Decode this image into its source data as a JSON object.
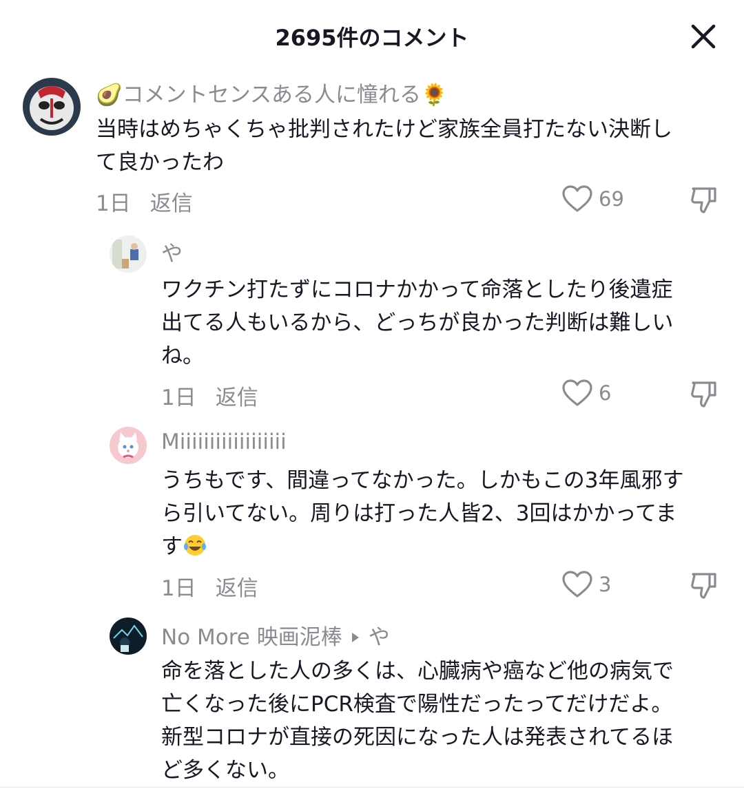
{
  "header": {
    "title": "2695件のコメント",
    "close_icon": "close-icon"
  },
  "comments": [
    {
      "username": "🥑コメントセンスある人に憧れる🌻",
      "lines": [
        "当時はめちゃくちゃ批判されたけど家族全員打たない決断し",
        "て良かったわ"
      ],
      "time": "1日",
      "reply": "返信",
      "likes": "69"
    },
    {
      "username": "や",
      "lines": [
        "ワクチン打たずにコロナかかって命落としたり後遺症",
        "出てる人もいるから、どっちが良かった判断は難しい",
        "ね。"
      ],
      "time": "1日",
      "reply": "返信",
      "likes": "6"
    },
    {
      "username": "Miiiiiiiiiiiiiiiiii",
      "lines": [
        "うちもです、間違ってなかった。しかもこの3年風邪す",
        "ら引いてない。周りは打った人皆2、3回はかかってま",
        "す"
      ],
      "emoji": "😂",
      "time": "1日",
      "reply": "返信",
      "likes": "3"
    },
    {
      "username": "No More 映画泥棒",
      "reply_to": "や",
      "lines": [
        "命を落とした人の多くは、心臓病や癌など他の病気で",
        "亡くなった後にPCR検査で陽性だったってだけだよ。",
        "新型コロナが直接の死因になった人は発表されてるほ",
        "ど多くない。"
      ]
    }
  ],
  "colors": {
    "text": "#161823",
    "secondary": "#8a8b91",
    "background": "#ffffff"
  },
  "icons": [
    "close-icon",
    "heart-icon",
    "dislike-icon",
    "caret-right-icon",
    "avatar"
  ]
}
